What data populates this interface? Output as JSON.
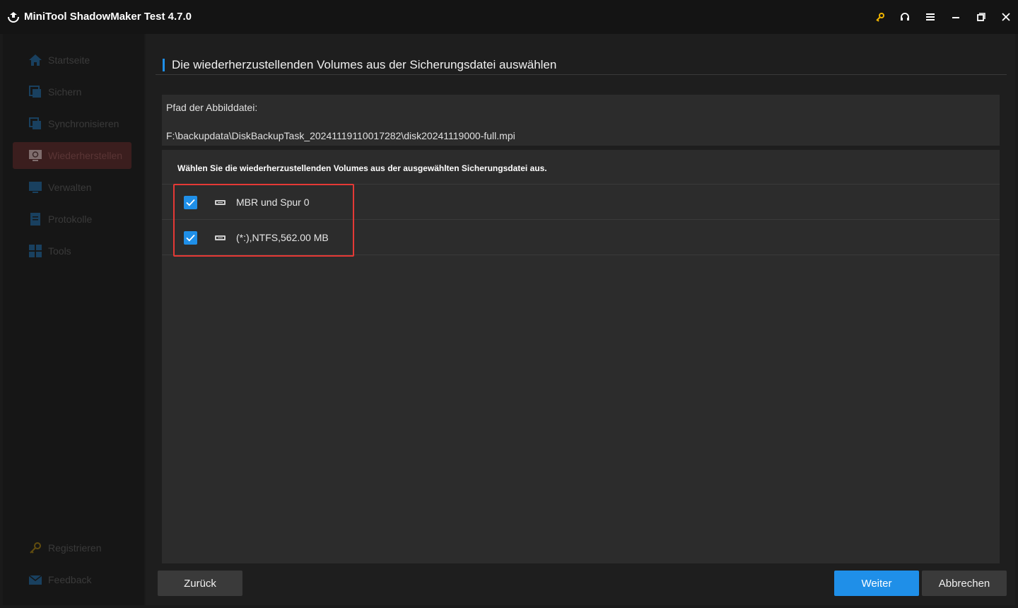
{
  "window": {
    "title": "MiniTool ShadowMaker Test 4.7.0",
    "controls": [
      "key-icon",
      "headset-icon",
      "menu-icon",
      "minimize-icon",
      "restore-icon",
      "close-icon"
    ]
  },
  "sidebar": {
    "items": [
      {
        "label": "Startseite",
        "icon": "home-icon"
      },
      {
        "label": "Sichern",
        "icon": "backup-icon"
      },
      {
        "label": "Synchronisieren",
        "icon": "sync-icon"
      },
      {
        "label": "Wiederherstellen",
        "icon": "restore-icon",
        "active": true
      },
      {
        "label": "Verwalten",
        "icon": "manage-icon"
      },
      {
        "label": "Protokolle",
        "icon": "logs-icon"
      },
      {
        "label": "Tools",
        "icon": "tools-icon"
      }
    ],
    "bottom": [
      {
        "label": "Registrieren",
        "icon": "key-icon"
      },
      {
        "label": "Feedback",
        "icon": "mail-icon"
      }
    ]
  },
  "main": {
    "title": "Die wiederherzustellenden Volumes aus der Sicherungsdatei auswählen",
    "path_label": "Pfad der Abbilddatei:",
    "path_value": "F:\\backupdata\\DiskBackupTask_20241119110017282\\disk20241119000-full.mpi",
    "instruction": "Wählen Sie die wiederherzustellenden Volumes aus der ausgewählten Sicherungsdatei aus.",
    "volumes": [
      {
        "label": "MBR und Spur 0",
        "checked": true
      },
      {
        "label": "(*:),NTFS,562.00 MB",
        "checked": true
      }
    ]
  },
  "buttons": {
    "back": "Zurück",
    "next": "Weiter",
    "cancel": "Abbrechen"
  },
  "colors": {
    "accent": "#1f8fe8",
    "highlight": "#e53935",
    "background": "#1e1e1e",
    "panel": "#2c2c2c"
  }
}
